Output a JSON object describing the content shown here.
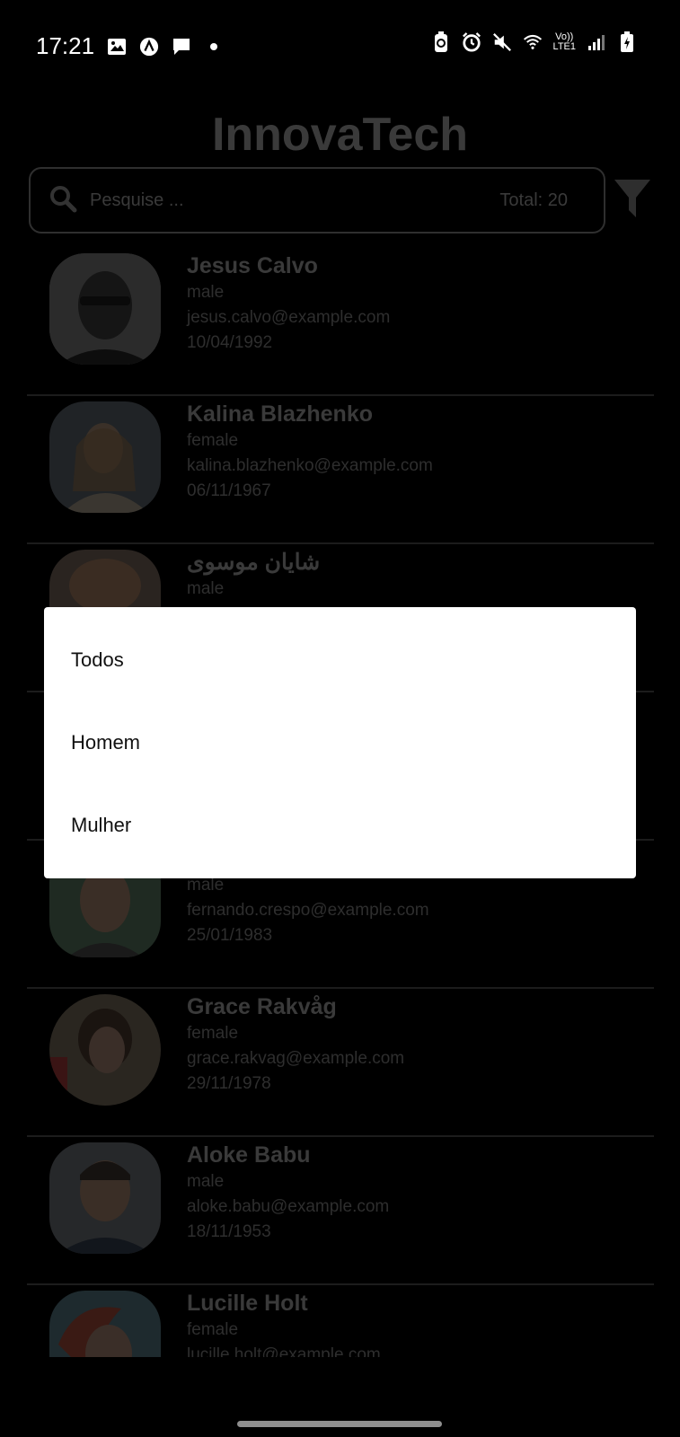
{
  "status_bar": {
    "time": "17:21",
    "left_icons": [
      "image-icon",
      "app-a-icon",
      "chat-icon",
      "dot-icon"
    ],
    "right_icons": [
      "recycle-icon",
      "alarm-icon",
      "mute-icon",
      "wifi-icon"
    ],
    "network_top": "Vo))",
    "network_bottom": "LTE1",
    "battery_icon": "battery-charging-icon"
  },
  "app": {
    "title": "InnovaTech",
    "search": {
      "placeholder": "Pesquise ...",
      "total": "Total: 20"
    },
    "filter_icon": "filter-icon"
  },
  "contacts": [
    {
      "name": "Jesus Calvo",
      "gender": "male",
      "email": "jesus.calvo@example.com",
      "date": "10/04/1992"
    },
    {
      "name": "Kalina Blazhenko",
      "gender": "female",
      "email": "kalina.blazhenko@example.com",
      "date": "06/11/1967"
    },
    {
      "name": "شايان موسوی",
      "gender": "male",
      "email": "",
      "date": ""
    },
    {
      "name": "",
      "gender": "",
      "email": "",
      "date": ""
    },
    {
      "name": "",
      "gender": "male",
      "email": "fernando.crespo@example.com",
      "date": "25/01/1983"
    },
    {
      "name": "Grace Rakvåg",
      "gender": "female",
      "email": "grace.rakvag@example.com",
      "date": "29/11/1978"
    },
    {
      "name": "Aloke Babu",
      "gender": "male",
      "email": "aloke.babu@example.com",
      "date": "18/11/1953"
    },
    {
      "name": "Lucille Holt",
      "gender": "female",
      "email": "lucille.holt@example.com",
      "date": ""
    }
  ],
  "popup_menu": {
    "items": [
      "Todos",
      "Homem",
      "Mulher"
    ]
  },
  "colors": {
    "background": "#000000",
    "popup": "#ffffff",
    "dimmed_text": "#3a3a3a"
  }
}
